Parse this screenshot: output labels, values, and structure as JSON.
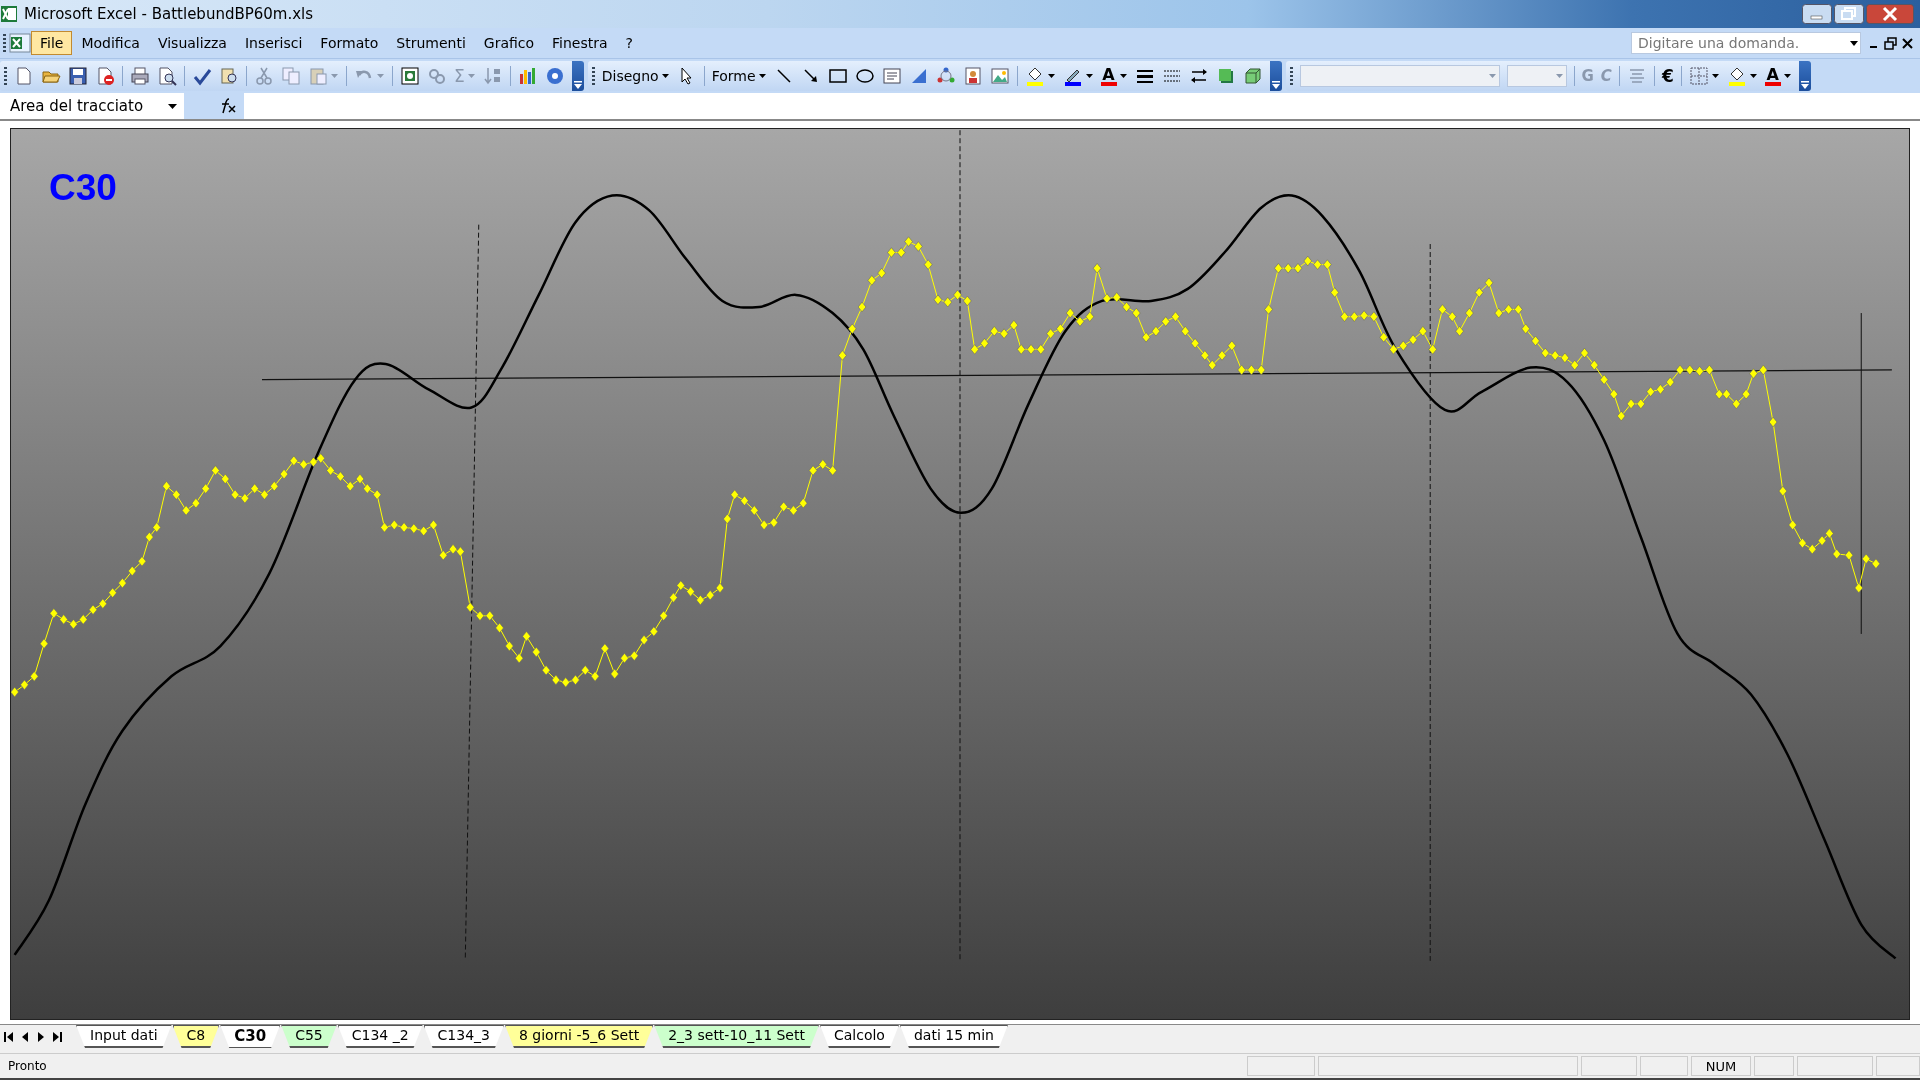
{
  "window": {
    "title": "Microsoft Excel - BattlebundBP60m.xls"
  },
  "menu": [
    {
      "label": "File",
      "selected": true
    },
    {
      "label": "Modifica",
      "selected": false
    },
    {
      "label": "Visualizza",
      "selected": false
    },
    {
      "label": "Inserisci",
      "selected": false
    },
    {
      "label": "Formato",
      "selected": false
    },
    {
      "label": "Strumenti",
      "selected": false
    },
    {
      "label": "Grafico",
      "selected": false
    },
    {
      "label": "Finestra",
      "selected": false
    },
    {
      "label": "?",
      "selected": false
    }
  ],
  "help_search": {
    "placeholder": "Digitare una domanda."
  },
  "toolbar": {
    "sum_symbol": "Σ",
    "drawing_label": "Disegno",
    "shapes_label": "Forme",
    "font_color_glyphs": [
      "A",
      "A"
    ],
    "bold_label": "G",
    "italic_label": "C",
    "currency_symbol": "€"
  },
  "name_box": {
    "value": "Area del tracciato"
  },
  "chart": {
    "title": "C30"
  },
  "sheet_tabs": [
    {
      "label": "Input dati",
      "selected": false,
      "color": "#ffffff"
    },
    {
      "label": "C8",
      "selected": false,
      "color": "#ffff99"
    },
    {
      "label": "C30",
      "selected": true,
      "color": "#ffffff"
    },
    {
      "label": "C55",
      "selected": false,
      "color": "#ccffcc"
    },
    {
      "label": "C134 _2",
      "selected": false,
      "color": "#ffffff"
    },
    {
      "label": "C134_3",
      "selected": false,
      "color": "#ffffff"
    },
    {
      "label": "8 giorni -5_6 Sett",
      "selected": false,
      "color": "#ffff99"
    },
    {
      "label": "2_3 sett-10_11 Sett",
      "selected": false,
      "color": "#ccffcc"
    },
    {
      "label": "Calcolo",
      "selected": false,
      "color": "#ffffff"
    },
    {
      "label": "dati 15 min",
      "selected": false,
      "color": "#ffffff"
    }
  ],
  "status_bar": {
    "text": "Pronto",
    "indicators": [
      "NUM"
    ]
  }
}
